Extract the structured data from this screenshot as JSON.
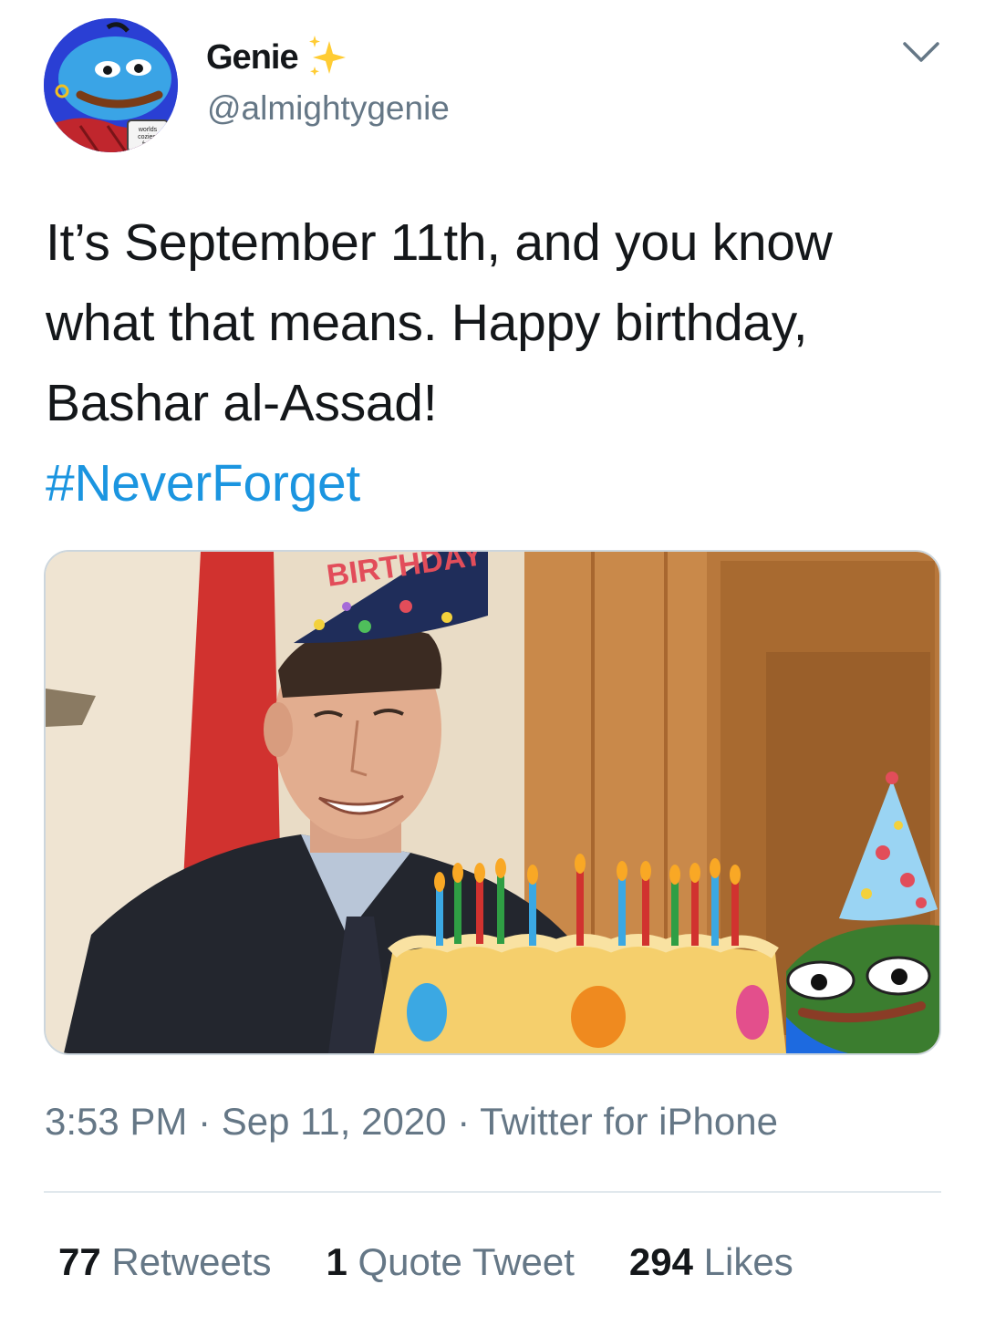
{
  "author": {
    "display_name": "Genie",
    "handle": "@almightygenie",
    "avatar_icon": "genie-pepe-avatar-icon",
    "badge_icon": "sparkles-icon",
    "mug_text": "worlds coziest fren"
  },
  "header": {
    "menu_icon": "chevron-down-icon"
  },
  "tweet": {
    "text": "It’s September 11th, and you know what that means. Happy birthday, Bashar al-Assad!",
    "hashtag": "#NeverForget",
    "hashtag_color": "#1b95e0"
  },
  "media": {
    "hat_text": "BIRTHDAY"
  },
  "meta": {
    "time": "3:53 PM",
    "separator": " · ",
    "date": "Sep 11, 2020",
    "source": "Twitter for iPhone"
  },
  "stats": {
    "retweets_count": "77",
    "retweets_label": "Retweets",
    "quotes_count": "1",
    "quotes_label": "Quote Tweet",
    "likes_count": "294",
    "likes_label": "Likes"
  },
  "colors": {
    "secondary_text": "#657786",
    "divider": "#e1e8ed",
    "accent": "#1b95e0"
  }
}
